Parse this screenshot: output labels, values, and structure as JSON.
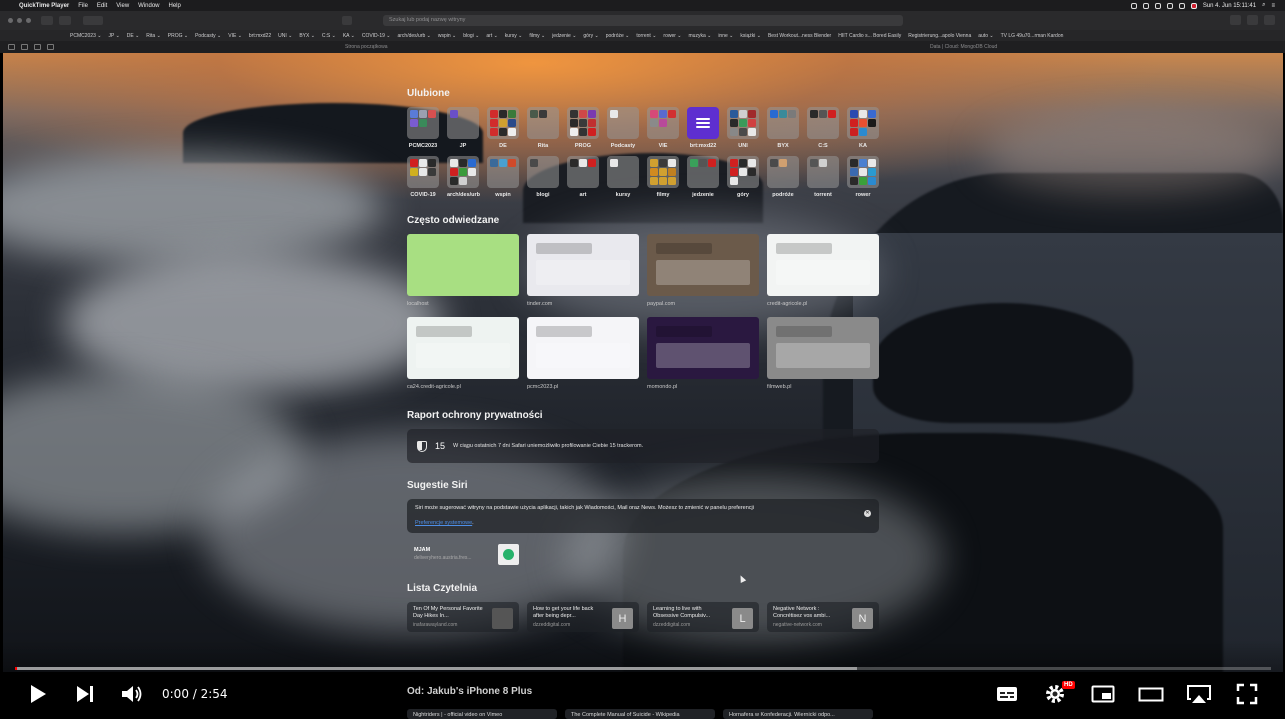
{
  "menubar": {
    "app": "QuickTime Player",
    "items": [
      "File",
      "Edit",
      "View",
      "Window",
      "Help"
    ],
    "clock": "Sun 4. Jun  15:11:41"
  },
  "safari": {
    "address_placeholder": "Szukaj lub podaj nazwę witryny",
    "bookmarks": [
      "PCMC2023 ⌄",
      "JP ⌄",
      "DE ⌄",
      "Rita ⌄",
      "PROG ⌄",
      "Podcasty ⌄",
      "VIE ⌄",
      "brt:mxd22",
      "UNI ⌄",
      "BYX ⌄",
      "C:S ⌄",
      "KA ⌄",
      "COVID-19 ⌄",
      "arch/des/urb ⌄",
      "wspin ⌄",
      "blogi ⌄",
      "art ⌄",
      "kursy ⌄",
      "filmy ⌄",
      "jedzenie ⌄",
      "góry ⌄",
      "podróże ⌄",
      "torrent ⌄",
      "rower ⌄",
      "muzyka ⌄",
      "inne ⌄",
      "książki ⌄",
      "Best Workout...ness Blender",
      "HIIT Cardio s... Bored Easily",
      "Registrierung...apolo Vienna",
      "auto ⌄",
      "TV LG 49u70...rman Kardon"
    ],
    "tab_left": "Strona początkowa",
    "tab_right": "Data | Cloud: MongoDB Cloud"
  },
  "favorites": {
    "title": "Ulubione",
    "items": [
      {
        "label": "PCMC2023",
        "colors": [
          "#5a7bd8",
          "#9aa0b0",
          "#d65050",
          "#7a5cd0",
          "#3a8a5a"
        ]
      },
      {
        "label": "JP",
        "colors": [
          "#6a4fc8"
        ]
      },
      {
        "label": "DE",
        "colors": [
          "#d12c2c",
          "#2a2a2a",
          "#3a7a3a",
          "#d12c2c",
          "#d0a030",
          "#2a4a8a",
          "#d12c2c",
          "#2a2a2a",
          "#eeeeee"
        ]
      },
      {
        "label": "Rita",
        "colors": [
          "#4a5a4a",
          "#3a3a3a"
        ]
      },
      {
        "label": "PROG",
        "colors": [
          "#333333",
          "#d04848",
          "#7a3ab0",
          "#2a2a2a",
          "#3a3a3a",
          "#c03030",
          "#eeeeee",
          "#333333",
          "#d02020"
        ]
      },
      {
        "label": "Podcasty",
        "colors": [
          "#e8e8e8"
        ]
      },
      {
        "label": "VIE",
        "colors": [
          "#d64a78",
          "#5a6ad0",
          "#d23030",
          "#8a8a8a",
          "#b84a9a"
        ]
      },
      {
        "label": "brt:mxd22",
        "colors": [],
        "purple": true
      },
      {
        "label": "UNI",
        "colors": [
          "#2a5a9a",
          "#d0d0d0",
          "#a02a2a",
          "#2a2a2a",
          "#3a9a5a",
          "#d04040",
          "#888888",
          "#4a4a4a",
          "#e8e8e8"
        ]
      },
      {
        "label": "BYX",
        "colors": [
          "#2a6ad0",
          "#3a8a9a",
          "#7a7a7a"
        ]
      },
      {
        "label": "C:S",
        "colors": [
          "#2a2a2a",
          "#555555",
          "#d02020"
        ]
      },
      {
        "label": "KA",
        "colors": [
          "#2a4ab0",
          "#e8e8e8",
          "#3a6ad0",
          "#d02020",
          "#e85030",
          "#1a1a1a",
          "#cc2020",
          "#2a8ad0"
        ]
      },
      {
        "label": "COVID-19",
        "colors": [
          "#d02020",
          "#e8e8e8",
          "#2a2a2a",
          "#d0b020",
          "#e8e8e8",
          "#3a3a3a"
        ]
      },
      {
        "label": "arch/des/urb",
        "colors": [
          "#e8e8e8",
          "#2a2a2a",
          "#2a6ad0",
          "#d02020",
          "#3a9a3a",
          "#e8e8e8",
          "#2a2a2a",
          "#d0d0d0"
        ]
      },
      {
        "label": "wspin",
        "colors": [
          "#3a6a9a",
          "#4aa0d0",
          "#d04a2a"
        ]
      },
      {
        "label": "blogi",
        "colors": [
          "#4a4a4a"
        ]
      },
      {
        "label": "art",
        "colors": [
          "#2a2a2a",
          "#e8e8e8",
          "#d02020"
        ]
      },
      {
        "label": "kursy",
        "colors": [
          "#e8e8e8"
        ]
      },
      {
        "label": "filmy",
        "colors": [
          "#d0a030",
          "#3a3a3a",
          "#e8e8e8",
          "#d08a20",
          "#d0a030",
          "#c08020",
          "#d0a030",
          "#d0a030",
          "#d0a030"
        ]
      },
      {
        "label": "jedzenie",
        "colors": [
          "#3aa05a",
          "#555555",
          "#d02020"
        ]
      },
      {
        "label": "góry",
        "colors": [
          "#d02020",
          "#2a2a2a",
          "#e8e8e8",
          "#d02020",
          "#e8e8e8",
          "#2a2a2a",
          "#e8e8e8"
        ]
      },
      {
        "label": "podróże",
        "colors": [
          "#4a4a4a",
          "#d0a070"
        ]
      },
      {
        "label": "torrent",
        "colors": [
          "#555555",
          "#d0d0d0"
        ]
      },
      {
        "label": "rower",
        "colors": [
          "#2a2a2a",
          "#4a80d0",
          "#e8e8e8",
          "#3a6ab0",
          "#e8e8e8",
          "#2a9ad0",
          "#2a2a2a",
          "#3aa03a",
          "#2a8ad0"
        ]
      }
    ]
  },
  "frequent": {
    "title": "Często odwiedzane",
    "items": [
      {
        "label": "localhost",
        "bg": "#a8df82"
      },
      {
        "label": "tinder.com",
        "bg": "#e9e9ee"
      },
      {
        "label": "paypal.com",
        "bg": "#6b5a4a"
      },
      {
        "label": "credit-agricole.pl",
        "bg": "#f2f4f3"
      },
      {
        "label": "ca24.credit-agricole.pl",
        "bg": "#eef3f1"
      },
      {
        "label": "pcmc2023.pl",
        "bg": "#f5f5f8"
      },
      {
        "label": "momondo.pl",
        "bg": "#2a1840"
      },
      {
        "label": "filmweb.pl",
        "bg": "#8a8a8a"
      }
    ]
  },
  "privacy": {
    "title": "Raport ochrony prywatności",
    "count": "15",
    "text": "W ciągu ostatnich 7 dni Safari uniemożliwiło profilowanie Ciebie 15 trackerom."
  },
  "siri": {
    "title": "Sugestie Siri",
    "text": "Siri może sugerować witryny na podstawie użycia aplikacji, takich jak Wiadomości, Mail oraz News. Możesz to zmienić w panelu preferencji",
    "link": "Preferencje systemowe",
    "link_suffix": ".",
    "suggestion": {
      "title": "MJAM",
      "url": "deliveryhero.austria.fres..."
    }
  },
  "reading": {
    "title": "Lista Czytelnia",
    "items": [
      {
        "title": "Ten Of My Personal Favorite Day Hikes In...",
        "site": "inafarawayland.com",
        "letter": ""
      },
      {
        "title": "How to get your life back after being depr...",
        "site": "dzzeddigital.com",
        "letter": "H"
      },
      {
        "title": "Learning to live with Obsessive Compulsiv...",
        "site": "dzzeddigital.com",
        "letter": "L"
      },
      {
        "title": "Negative Network : Concrétisez vos ambi...",
        "site": "negative-network.com",
        "letter": "N"
      }
    ]
  },
  "iphone": {
    "title": "Od: Jakub's iPhone 8 Plus",
    "items": [
      "Nightriders | - official video on Vimeo",
      "The Complete Manual of Suicide - Wikipedia",
      "Hornafera w Konfederacji. Wiernicki odpo..."
    ]
  },
  "player": {
    "time": "0:00 / 2:54",
    "progress_played": 0.0,
    "progress_buffered": 0.67,
    "hd_badge": "HD"
  }
}
